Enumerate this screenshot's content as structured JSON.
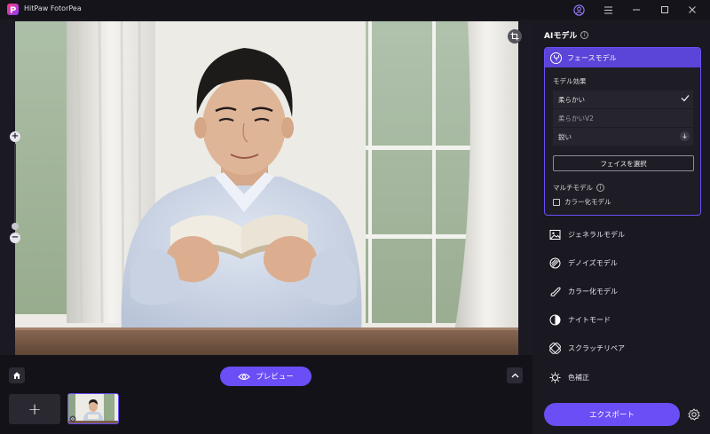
{
  "app": {
    "title": "HitPaw FotorPea"
  },
  "window_controls": {
    "icons": [
      "user-icon",
      "menu-icon",
      "minimize-icon",
      "maximize-icon",
      "close-icon"
    ]
  },
  "canvas": {
    "icons": [
      "crop-icon",
      "zoom-in-icon",
      "zoom-out-icon"
    ]
  },
  "bottom": {
    "preview_label": "プレビュー",
    "add_label": "+"
  },
  "panel": {
    "title": "AIモデル",
    "face_model": {
      "label": "フェースモデル",
      "effect_label": "モデル効果",
      "options": [
        {
          "label": "柔らかい",
          "selected": true
        },
        {
          "label": "柔らかいV2",
          "selected": false
        },
        {
          "label": "鋭い",
          "selected": false
        }
      ],
      "select_face_label": "フェイスを選択",
      "multi_label": "マルチモデル",
      "colorize_label": "カラー化モデル",
      "colorize_checked": false
    },
    "models": [
      {
        "label": "ジェネラルモデル",
        "icon": "image-icon"
      },
      {
        "label": "デノイズモデル",
        "icon": "denoise-icon"
      },
      {
        "label": "カラー化モデル",
        "icon": "brush-icon"
      },
      {
        "label": "ナイトモード",
        "icon": "half-circle-icon"
      },
      {
        "label": "スクラッチリペア",
        "icon": "patch-icon"
      },
      {
        "label": "色補正",
        "icon": "sun-icon"
      }
    ],
    "export_label": "エクスポート"
  },
  "colors": {
    "accent": "#6b4ef5",
    "background": "#131219",
    "panel": "#1a1922"
  }
}
